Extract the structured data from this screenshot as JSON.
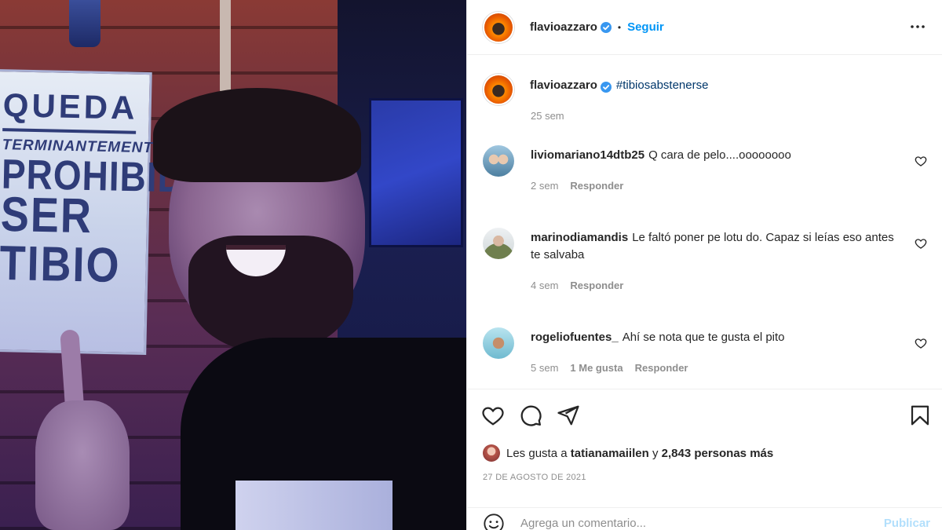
{
  "photo": {
    "sign_lines": [
      "QUEDA",
      "TERMINANTEMENTE",
      "PROHIBIDO",
      "SER TIBIO"
    ]
  },
  "header": {
    "username": "flavioazzaro",
    "separator": "•",
    "follow_label": "Seguir",
    "more_icon": "more-horizontal-icon"
  },
  "caption": {
    "username": "flavioazzaro",
    "hashtag": "#tibiosabstenerse",
    "time": "25 sem"
  },
  "comments": [
    {
      "username": "liviomariano14dtb25",
      "text": "Q cara de pelo....oooooooo",
      "time": "2 sem",
      "likes": "",
      "reply": "Responder"
    },
    {
      "username": "marinodiamandis",
      "text": "Le faltó poner pe lotu do. Capaz si leías eso antes te salvaba",
      "time": "4 sem",
      "likes": "",
      "reply": "Responder"
    },
    {
      "username": "rogeliofuentes_",
      "text": "Ahí se nota que te gusta el pito",
      "time": "5 sem",
      "likes": "1 Me gusta",
      "reply": "Responder"
    }
  ],
  "likes": {
    "prefix": "Les gusta a",
    "user": "tatianamaiilen",
    "conjunction": "y",
    "others": "2,843 personas más"
  },
  "date": "27 DE AGOSTO DE 2021",
  "add_comment": {
    "placeholder": "Agrega un comentario...",
    "publish_label": "Publicar"
  },
  "colors": {
    "accent": "#0095f6",
    "hashtag": "#00376b",
    "muted": "#8e8e8e",
    "publish_disabled": "#b2dffc"
  }
}
